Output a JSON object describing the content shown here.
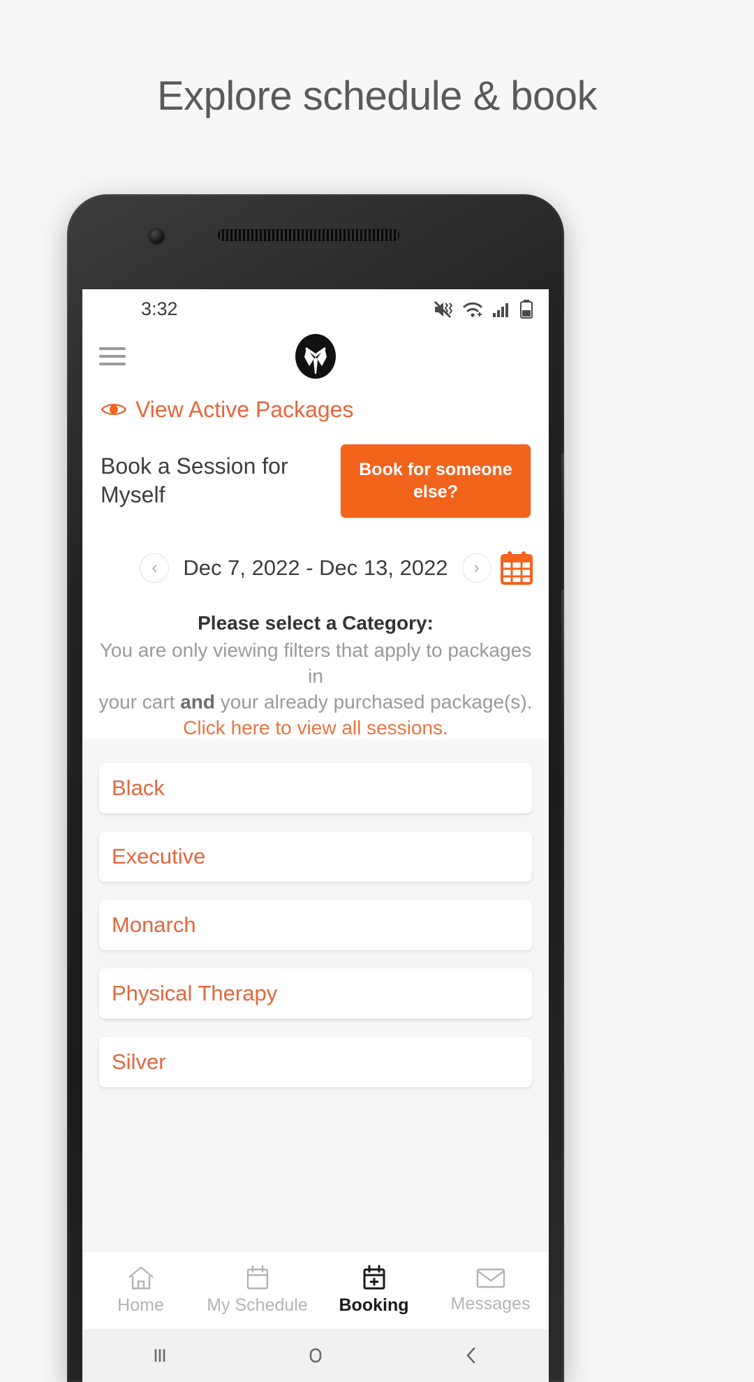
{
  "page": {
    "headline": "Explore schedule & book"
  },
  "status_bar": {
    "time": "3:32",
    "icons": [
      "mute-vibrate-icon",
      "wifi-icon",
      "signal-icon",
      "battery-icon"
    ]
  },
  "app_header": {
    "menu_icon": "hamburger-menu-icon",
    "logo": "butler-suit-logo"
  },
  "active_packages": {
    "icon": "eye-icon",
    "label": "View Active Packages"
  },
  "booking": {
    "title": "Book a Session for Myself",
    "book_for_someone_else": "Book for someone else?"
  },
  "date_nav": {
    "prev_label": "‹",
    "next_label": "›",
    "range": "Dec 7, 2022 - Dec 13, 2022",
    "calendar_icon": "calendar-icon"
  },
  "notice": {
    "title": "Please select a Category:",
    "line1": "You are only viewing filters that apply to packages in",
    "line2_a": "your cart ",
    "line2_bold": "and",
    "line2_b": " your already purchased package(s).",
    "link": "Click here to view all sessions."
  },
  "categories": [
    {
      "label": "Black"
    },
    {
      "label": "Executive"
    },
    {
      "label": "Monarch"
    },
    {
      "label": "Physical Therapy"
    },
    {
      "label": "Silver"
    }
  ],
  "tabs": [
    {
      "label": "Home",
      "icon": "home-icon",
      "active": false
    },
    {
      "label": "My Schedule",
      "icon": "calendar-icon",
      "active": false
    },
    {
      "label": "Booking",
      "icon": "calendar-plus-icon",
      "active": true
    },
    {
      "label": "Messages",
      "icon": "envelope-icon",
      "active": false
    }
  ],
  "android_nav": {
    "recents": "recents-icon",
    "home": "home-circle-icon",
    "back": "back-chevron-icon"
  },
  "colors": {
    "accent_orange": "#f2631c",
    "link_orange": "#e8753f",
    "category_orange": "#e2673c",
    "headline_gray": "#5a5a5a"
  }
}
